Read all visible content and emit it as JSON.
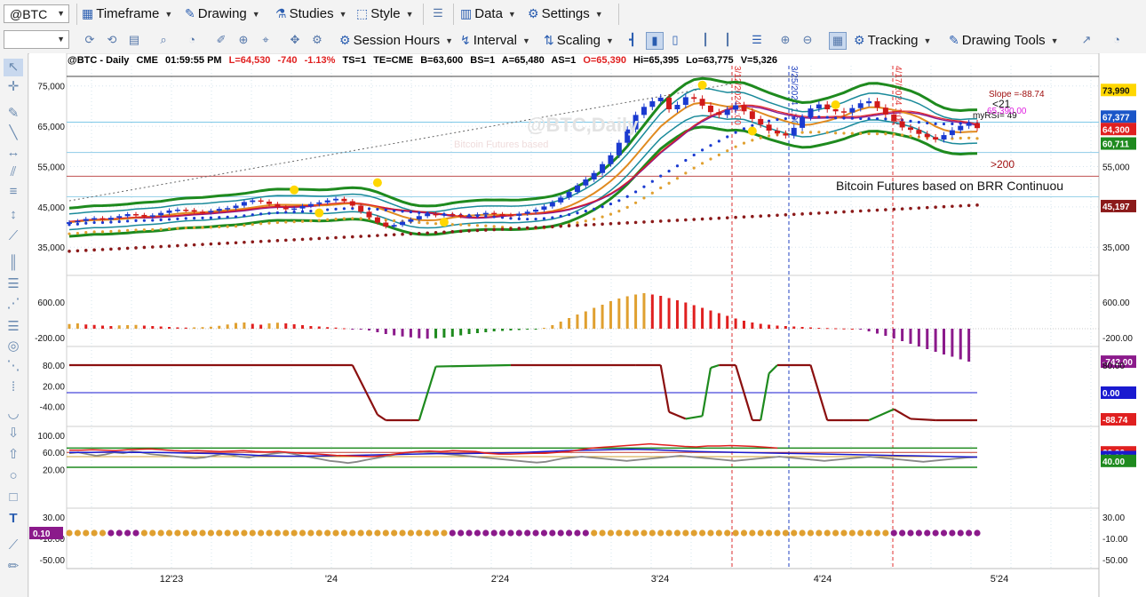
{
  "toolbar1": {
    "symbol": "@BTC",
    "menus": [
      {
        "label": "Timeframe",
        "icon": "calendar-icon"
      },
      {
        "label": "Drawing",
        "icon": "pencil-icon"
      },
      {
        "label": "Studies",
        "icon": "flask-icon"
      },
      {
        "label": "Style",
        "icon": "style-icon"
      },
      {
        "label": "Data",
        "icon": "data-icon"
      },
      {
        "label": "Settings",
        "icon": "gear-icon"
      }
    ]
  },
  "toolbar2": {
    "interval_value": "",
    "menus": [
      {
        "label": "Session Hours",
        "icon": "clock-icon"
      },
      {
        "label": "Interval",
        "icon": "interval-icon"
      },
      {
        "label": "Scaling",
        "icon": "scaling-icon"
      },
      {
        "label": "Tracking",
        "icon": "tracking-icon"
      },
      {
        "label": "Drawing Tools",
        "icon": "drawing-tools-icon"
      }
    ]
  },
  "header": {
    "symbol": "@BTC - Daily",
    "exch": "CME",
    "time": "01:59:55 PM",
    "last": "L=64,530",
    "chg": "-740",
    "pct": "-1.13%",
    "ts": "TS=1",
    "te": "TE=CME",
    "bid": "B=63,600",
    "bs": "BS=1",
    "ask": "A=65,480",
    "as": "AS=1",
    "open": "O=65,390",
    "high": "Hi=65,395",
    "low": "Lo=63,775",
    "vol": "V=5,326"
  },
  "watermark": {
    "symbol": "@BTC,Daily",
    "desc": "Bitcoin Futures based"
  },
  "annotations": {
    "description": "Bitcoin Futures based on BRR Continuou",
    "slope": "Slope =-88.74",
    "lt21": "<21",
    "gt200": ">200",
    "myrsi": "myRSI= 49",
    "magenta": "65,390.00"
  },
  "chart_data": {
    "type": "candlestick",
    "x_ticks": [
      "12'23",
      "'24",
      "2'24",
      "3'24",
      "4'24",
      "5'24"
    ],
    "panels": [
      {
        "name": "price",
        "y_ticks": [
          "75,000",
          "65,000",
          "55,000",
          "45,000",
          "35,000"
        ],
        "ylim": [
          28000,
          80000
        ],
        "right_labels": [
          {
            "text": "73,990",
            "bg": "#ffd700",
            "fg": "#111",
            "v": 73990
          },
          {
            "text": "67,377",
            "bg": "#1a56c8",
            "fg": "#fff",
            "v": 67377
          },
          {
            "text": "64,300",
            "bg": "#e02020",
            "fg": "#fff",
            "v": 64300
          },
          {
            "text": "60,711",
            "bg": "#1e8a1e",
            "fg": "#fff",
            "v": 60711
          },
          {
            "text": "45,197",
            "bg": "#8b1a1a",
            "fg": "#fff",
            "v": 45197
          }
        ],
        "right_ticks": [
          {
            "t": "55,000",
            "v": 55000
          },
          {
            "t": "35,000",
            "v": 35000
          }
        ]
      },
      {
        "name": "histogram",
        "y_ticks": [
          "600.00",
          "-200.00"
        ],
        "right_labels": [
          {
            "text": "-742.00",
            "bg": "#8b1a8b",
            "fg": "#fff"
          }
        ],
        "right_ticks": [
          "600.00",
          "-200.00"
        ]
      },
      {
        "name": "oscillator",
        "y_ticks": [
          "80.00",
          "20.00",
          "-40.00"
        ],
        "right_labels": [
          {
            "text": "0.00",
            "bg": "#1a1ad0",
            "fg": "#fff"
          },
          {
            "text": "-88.74",
            "bg": "#e02020",
            "fg": "#fff"
          }
        ],
        "right_ticks": [
          "80.00"
        ]
      },
      {
        "name": "rsi",
        "y_ticks": [
          "100.00",
          "60.00",
          "20.00"
        ],
        "right_labels": [
          {
            "text": "60.00",
            "bg": "#e02020",
            "fg": "#fff"
          },
          {
            "text": "49.00",
            "bg": "#1a1ad0",
            "fg": "#fff"
          },
          {
            "text": "40.00",
            "bg": "#1e8a1e",
            "fg": "#fff"
          }
        ]
      },
      {
        "name": "dots",
        "y_ticks": [
          "30.00",
          "-10.00",
          "-50.00"
        ],
        "left_label": "0.10",
        "right_ticks": [
          "30.00",
          "-10.00",
          "-50.00"
        ]
      }
    ],
    "vlines": [
      {
        "label": "3/12/2024 1:00",
        "color": "#e03030"
      },
      {
        "label": "3/25/2024 1:00",
        "color": "#2040c0"
      },
      {
        "label": "4/17/2024 1:00",
        "color": "#e03030"
      }
    ],
    "price_path": [
      41200,
      41500,
      42000,
      42200,
      41800,
      42300,
      42700,
      43200,
      43000,
      42600,
      42900,
      43500,
      44100,
      44300,
      44200,
      43800,
      43600,
      44000,
      44500,
      44700,
      45300,
      46200,
      46600,
      46300,
      45700,
      44900,
      44400,
      44600,
      45200,
      45700,
      46100,
      46600,
      47000,
      46400,
      45300,
      43800,
      42400,
      41100,
      40100,
      40500,
      41300,
      41900,
      42700,
      43300,
      42900,
      43200,
      43000,
      42700,
      42800,
      43100,
      43500,
      43200,
      43000,
      42800,
      43300,
      43800,
      44300,
      45100,
      46100,
      47300,
      48700,
      50300,
      51800,
      53400,
      55600,
      57800,
      60900,
      64200,
      67800,
      69800,
      71200,
      72100,
      69200,
      70300,
      72200,
      71800,
      70100,
      68500,
      67800,
      69100,
      70200,
      68700,
      66800,
      65400,
      63900,
      63200,
      62700,
      64600,
      67200,
      69400,
      70400,
      69200,
      68700,
      68400,
      69500,
      70700,
      71200,
      69600,
      67900,
      66200,
      64700,
      64100,
      63100,
      62300,
      61700,
      62800,
      64000,
      65100,
      65800,
      64530
    ],
    "hist": [
      105,
      120,
      95,
      85,
      70,
      60,
      75,
      80,
      85,
      70,
      60,
      50,
      40,
      30,
      25,
      30,
      35,
      45,
      65,
      95,
      130,
      140,
      110,
      90,
      120,
      135,
      120,
      100,
      80,
      60,
      50,
      35,
      25,
      10,
      -5,
      -20,
      -40,
      -80,
      -120,
      -150,
      -175,
      -195,
      -215,
      -225,
      -215,
      -200,
      -180,
      -150,
      -120,
      -100,
      -80,
      -60,
      -50,
      -40,
      -30,
      -20,
      -10,
      20,
      80,
      160,
      240,
      320,
      390,
      470,
      540,
      620,
      680,
      730,
      770,
      800,
      770,
      740,
      690,
      640,
      590,
      530,
      470,
      410,
      350,
      290,
      230,
      180,
      140,
      110,
      90,
      70,
      60,
      50,
      40,
      30,
      20,
      15,
      10,
      5,
      0,
      -20,
      -60,
      -110,
      -160,
      -220,
      -280,
      -340,
      -400,
      -460,
      -520,
      -580,
      -630,
      -690,
      -742
    ],
    "osc_path": [
      [
        0,
        100
      ],
      [
        34,
        100
      ],
      [
        37,
        -80
      ],
      [
        38,
        -100
      ],
      [
        41,
        -100
      ],
      [
        42,
        -100
      ],
      [
        44,
        95
      ],
      [
        53,
        100
      ],
      [
        68,
        100
      ],
      [
        71,
        100
      ],
      [
        72,
        -70
      ],
      [
        74,
        -95
      ],
      [
        76,
        -85
      ],
      [
        77,
        90
      ],
      [
        78,
        100
      ],
      [
        80,
        100
      ],
      [
        82,
        -100
      ],
      [
        83,
        -100
      ],
      [
        84,
        70
      ],
      [
        85,
        100
      ],
      [
        89,
        100
      ],
      [
        91,
        -100
      ],
      [
        93,
        -100
      ],
      [
        96,
        -100
      ],
      [
        99,
        -60
      ],
      [
        101,
        -95
      ],
      [
        104,
        -100
      ],
      [
        109,
        -100
      ]
    ],
    "rsi_red": [
      65,
      65,
      66,
      65,
      64,
      66,
      67,
      68,
      66,
      64,
      63,
      64,
      63,
      62,
      63,
      64,
      62,
      61,
      62,
      60,
      58,
      57,
      55,
      53,
      52,
      51,
      50,
      52,
      56,
      60,
      62,
      63,
      62,
      64,
      63,
      62,
      58,
      56,
      56,
      57,
      58,
      58,
      60,
      62,
      66,
      70,
      72,
      74,
      76,
      78,
      80,
      78,
      76,
      74,
      73,
      75,
      75,
      76,
      75,
      74,
      72,
      70
    ],
    "rsi_blue": [
      60,
      60,
      61,
      60,
      60,
      59,
      58,
      57,
      55,
      52,
      51,
      51,
      52,
      53,
      54,
      55,
      56,
      57,
      57,
      58,
      59,
      60,
      62,
      64,
      65,
      66,
      67,
      66,
      64,
      62,
      61,
      60,
      59,
      58,
      57,
      56,
      55,
      54,
      53,
      52,
      51,
      50,
      49
    ],
    "rsi_gray": [
      58,
      60,
      56,
      52,
      55,
      60,
      58,
      62,
      60,
      56,
      54,
      52,
      50,
      48,
      46,
      48,
      52,
      56,
      54,
      50,
      48,
      52,
      55,
      58,
      60,
      56,
      52,
      48,
      44,
      40,
      38,
      35,
      38,
      42,
      46,
      50,
      54,
      58,
      60,
      62,
      60,
      58,
      56,
      54,
      52,
      50,
      48,
      46,
      44,
      42,
      40,
      38,
      36,
      38,
      42,
      46,
      48,
      50,
      48,
      46,
      44,
      42,
      40,
      42,
      44,
      46,
      48,
      50,
      52,
      50,
      48,
      46,
      44,
      42,
      40,
      42,
      44,
      46,
      48,
      50,
      48,
      46,
      44,
      42,
      40,
      42,
      44,
      46,
      48,
      50,
      48,
      46,
      44,
      42,
      40,
      38,
      40,
      42,
      44,
      46,
      48,
      49
    ],
    "dot_colors_purple_ranges": [
      [
        5,
        8
      ],
      [
        46,
        62
      ],
      [
        99,
        109
      ]
    ]
  }
}
